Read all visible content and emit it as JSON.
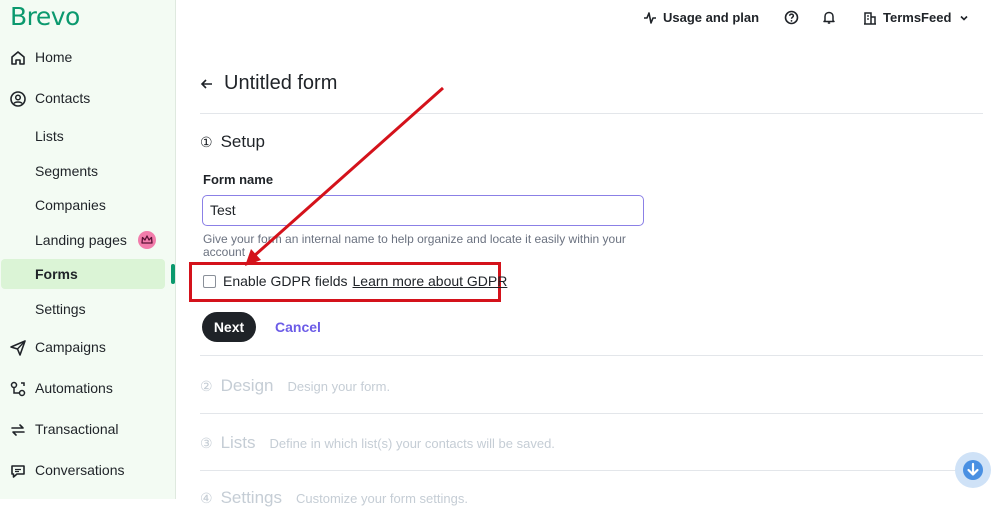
{
  "app": {
    "logo": "Brevo"
  },
  "sidebar": {
    "items": [
      {
        "label": "Home",
        "icon": "home-icon"
      },
      {
        "label": "Contacts",
        "icon": "contacts-icon"
      },
      {
        "label": "Campaigns",
        "icon": "campaigns-icon"
      },
      {
        "label": "Automations",
        "icon": "automations-icon"
      },
      {
        "label": "Transactional",
        "icon": "transactional-icon"
      },
      {
        "label": "Conversations",
        "icon": "conversations-icon"
      }
    ],
    "contacts_sub": [
      {
        "label": "Lists"
      },
      {
        "label": "Segments"
      },
      {
        "label": "Companies"
      },
      {
        "label": "Landing pages",
        "badge_icon": "crown-icon"
      },
      {
        "label": "Forms",
        "active": true
      },
      {
        "label": "Settings"
      }
    ]
  },
  "topbar": {
    "usage_label": "Usage and plan",
    "account_name": "TermsFeed"
  },
  "page": {
    "title": "Untitled form",
    "steps": [
      {
        "num": "①",
        "title": "Setup"
      },
      {
        "num": "②",
        "title": "Design",
        "desc": "Design your form."
      },
      {
        "num": "③",
        "title": "Lists",
        "desc": "Define in which list(s) your contacts will be saved."
      },
      {
        "num": "④",
        "title": "Settings",
        "desc": "Customize your form settings."
      }
    ],
    "form_name_label": "Form name",
    "form_name_value": "Test",
    "help_text": "Give your form an internal name to help organize and locate it easily within your account",
    "gdpr_label": "Enable GDPR fields",
    "gdpr_link": "Learn more about GDPR",
    "next_label": "Next",
    "cancel_label": "Cancel"
  },
  "colors": {
    "brand": "#0b996e",
    "accent": "#6c5ce7",
    "highlight": "#d4121b",
    "active_bg": "#dbf4d6"
  }
}
